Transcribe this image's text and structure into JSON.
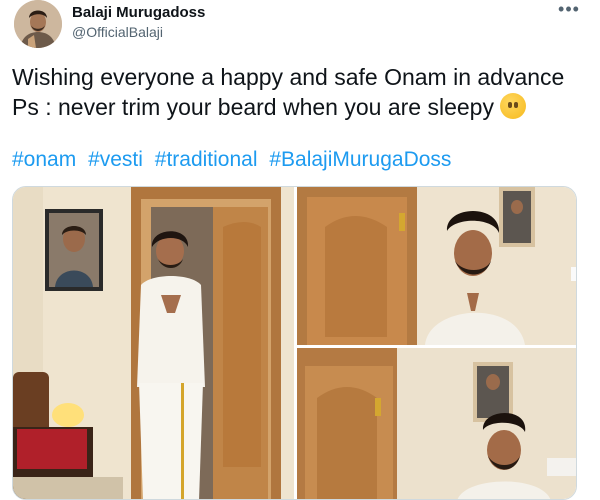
{
  "author": {
    "name": "Balaji Murugadoss",
    "handle": "@OfficialBalaji"
  },
  "tweet": {
    "line1": "Wishing everyone a happy and safe Onam in advance",
    "line2": "Ps : never trim your beard when you are sleepy",
    "emoji_icon": "face-without-mouth-emoji",
    "hashtags": [
      "#onam",
      "#vesti",
      "#traditional",
      "#BalajiMurugaDoss"
    ]
  },
  "more_icon": "more-dots-icon",
  "colors": {
    "link": "#1d9bf0",
    "text": "#0f1419",
    "muted": "#536471",
    "border": "#cfd9de"
  },
  "media": {
    "photo_count": 3
  }
}
